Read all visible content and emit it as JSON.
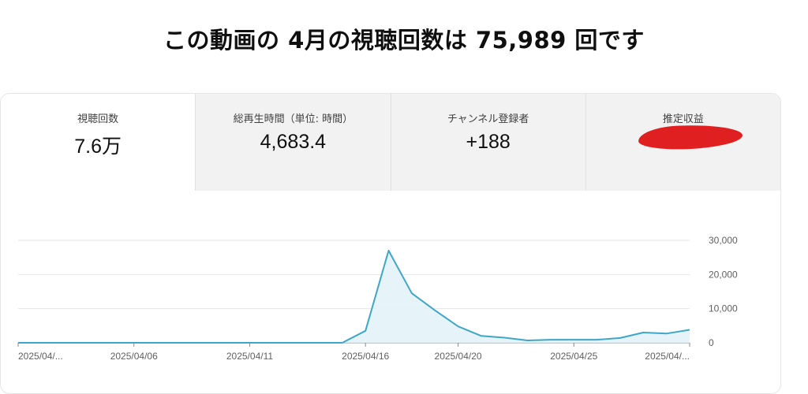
{
  "headline": "この動画の 4月の視聴回数は 75,989 回です",
  "metrics": [
    {
      "label": "視聴回数",
      "value": "7.6万"
    },
    {
      "label": "総再生時間（単位: 時間）",
      "value": "4,683.4"
    },
    {
      "label": "チャンネル登録者",
      "value": "+188"
    },
    {
      "label": "推定収益",
      "value": ""
    }
  ],
  "colors": {
    "line": "#3ea6c8",
    "fill": "#e3f3f9",
    "redaction": "#e02020"
  },
  "chart_data": {
    "type": "area",
    "x_tick_labels": [
      "2025/04/...",
      "2025/04/06",
      "2025/04/11",
      "2025/04/16",
      "2025/04/20",
      "2025/04/25",
      "2025/04/..."
    ],
    "x": [
      "2025/04/01",
      "2025/04/02",
      "2025/04/03",
      "2025/04/04",
      "2025/04/05",
      "2025/04/06",
      "2025/04/07",
      "2025/04/08",
      "2025/04/09",
      "2025/04/10",
      "2025/04/11",
      "2025/04/12",
      "2025/04/13",
      "2025/04/14",
      "2025/04/15",
      "2025/04/16",
      "2025/04/17",
      "2025/04/18",
      "2025/04/19",
      "2025/04/20",
      "2025/04/21",
      "2025/04/22",
      "2025/04/23",
      "2025/04/24",
      "2025/04/25",
      "2025/04/26",
      "2025/04/27",
      "2025/04/28",
      "2025/04/29",
      "2025/04/30"
    ],
    "values": [
      0,
      0,
      0,
      0,
      0,
      0,
      0,
      0,
      0,
      0,
      0,
      0,
      0,
      0,
      0,
      3500,
      27000,
      14500,
      9500,
      4800,
      2000,
      1500,
      700,
      900,
      900,
      900,
      1400,
      3000,
      2700,
      3800
    ],
    "y_tick_labels": [
      "0",
      "10,000",
      "20,000",
      "30,000"
    ],
    "ylim": [
      0,
      30000
    ],
    "grid": true
  }
}
